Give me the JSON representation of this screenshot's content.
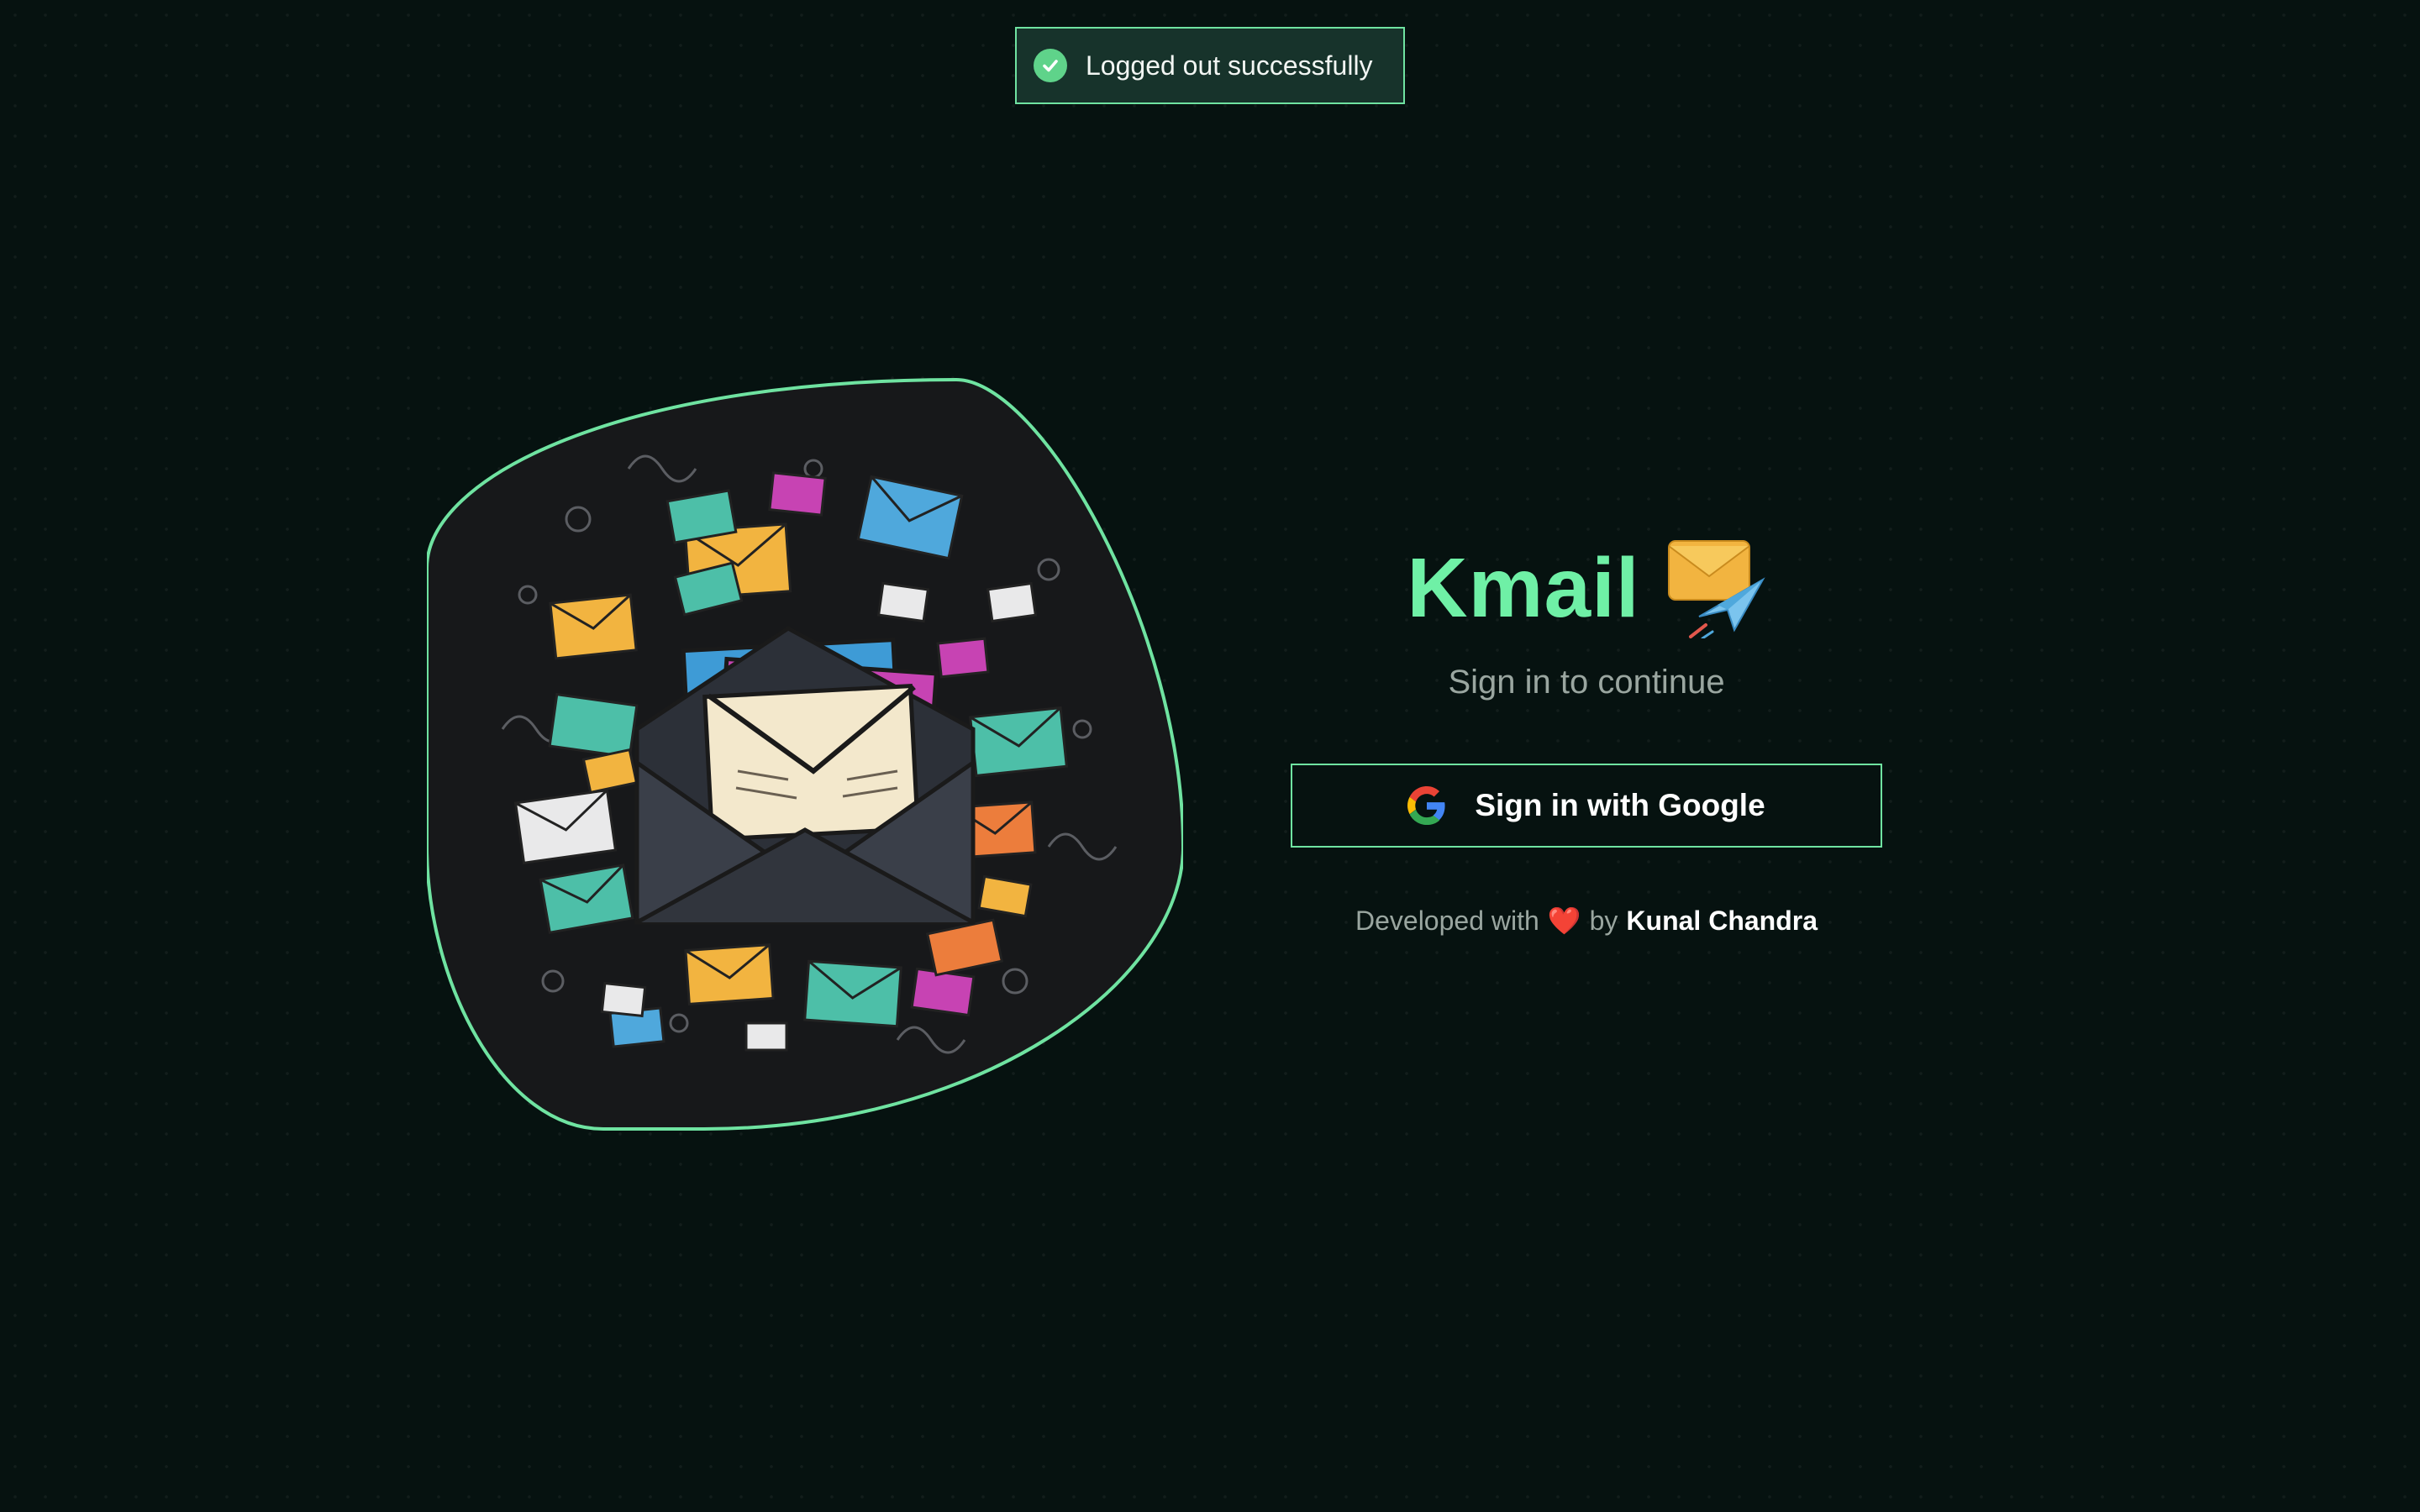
{
  "toast": {
    "message": "Logged out successfully",
    "icon": "check-circle-icon",
    "accent": "#5fd38a"
  },
  "illustration": {
    "border_color": "#6fe3a1",
    "fill_color": "#181819"
  },
  "login": {
    "title": "Kmail",
    "title_color": "#6ff0a6",
    "title_icon": "envelope-with-paper-plane-icon",
    "subtitle": "Sign in to continue",
    "google_button_label": "Sign in with Google",
    "google_icon": "google-g-icon"
  },
  "footer": {
    "prefix": "Developed with",
    "heart": "❤️",
    "by": "by",
    "author": "Kunal Chandra"
  },
  "colors": {
    "background": "#061210",
    "accent": "#6fe3a1",
    "muted_text": "#9aa6a0"
  }
}
